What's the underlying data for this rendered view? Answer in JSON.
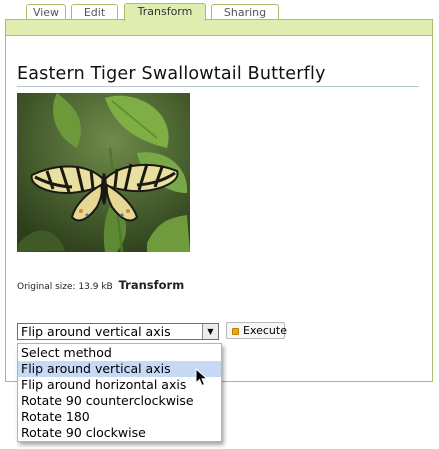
{
  "tabs": [
    {
      "label": "View",
      "active": false
    },
    {
      "label": "Edit",
      "active": false
    },
    {
      "label": "Transform",
      "active": true
    },
    {
      "label": "Sharing",
      "active": false
    }
  ],
  "page": {
    "title": "Eastern Tiger Swallowtail Butterfly",
    "original_size_label": "Original size: 13.9 kB",
    "section_heading": "Transform"
  },
  "transform": {
    "selected_value": "Flip around vertical axis",
    "execute_label": "Execute",
    "options": [
      "Select method",
      "Flip around vertical axis",
      "Flip around horizontal axis",
      "Rotate 90 counterclockwise",
      "Rotate 180",
      "Rotate 90 clockwise"
    ],
    "highlighted_option_index": 1
  },
  "colors": {
    "tab_border": "#a8bf6a",
    "active_tab_bg": "#dfeeb0",
    "highlight": "#c6daf5"
  }
}
